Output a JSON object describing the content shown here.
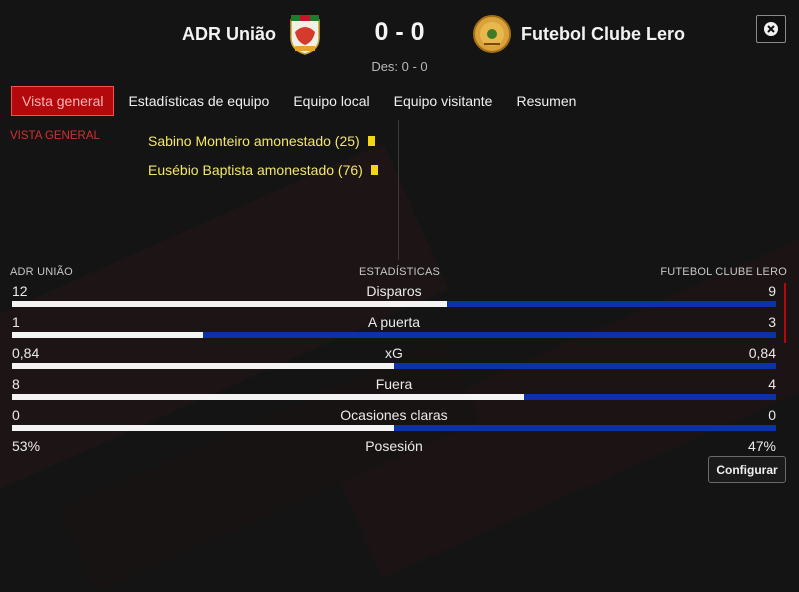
{
  "colors": {
    "accent_red": "#b3090c",
    "home_bar": "#f4f4f4",
    "away_bar": "#0b32a6",
    "event_yellow": "#f3e66a",
    "card_yellow": "#f2d70c"
  },
  "match": {
    "home_team": "ADR União",
    "away_team": "Futebol Clube Lero",
    "score": "0 - 0",
    "halftime": "Des: 0 - 0",
    "home_crest_icon": "adr-uniao-crest-icon",
    "away_crest_icon": "fc-lero-crest-icon",
    "close_icon": "close-icon"
  },
  "tabs": [
    {
      "label": "Vista general",
      "active": true
    },
    {
      "label": "Estadísticas de equipo",
      "active": false
    },
    {
      "label": "Equipo local",
      "active": false
    },
    {
      "label": "Equipo visitante",
      "active": false
    },
    {
      "label": "Resumen",
      "active": false
    }
  ],
  "overview": {
    "section_label": "VISTA GENERAL",
    "events": [
      {
        "text": "Sabino Monteiro amonestado (25)",
        "icon": "yellow-card-icon"
      },
      {
        "text": "Eusébio Baptista amonestado (76)",
        "icon": "yellow-card-icon"
      }
    ]
  },
  "stats": {
    "home_header": "ADR UNIÃO",
    "title": "ESTADÍSTICAS",
    "away_header": "FUTEBOL CLUBE LERO",
    "rows": [
      {
        "label": "Disparos",
        "home": "12",
        "away": "9",
        "home_share": 0.57
      },
      {
        "label": "A puerta",
        "home": "1",
        "away": "3",
        "home_share": 0.25
      },
      {
        "label": "xG",
        "home": "0,84",
        "away": "0,84",
        "home_share": 0.5
      },
      {
        "label": "Fuera",
        "home": "8",
        "away": "4",
        "home_share": 0.67
      },
      {
        "label": "Ocasiones claras",
        "home": "0",
        "away": "0",
        "home_share": 0.5
      },
      {
        "label": "Posesión",
        "home": "53%",
        "away": "47%",
        "home_share": 0.53
      }
    ]
  },
  "footer": {
    "config_label": "Configurar"
  }
}
